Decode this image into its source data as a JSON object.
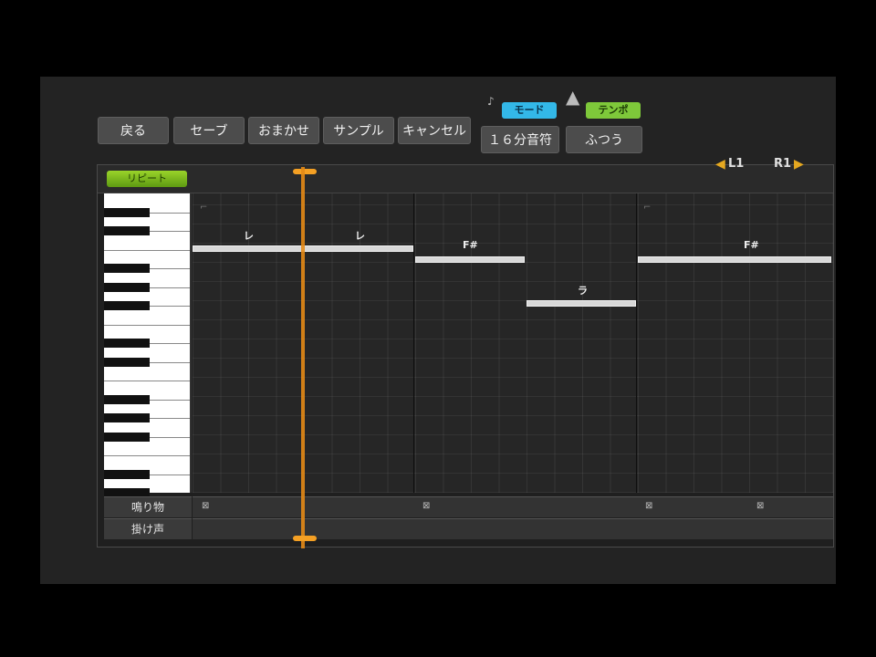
{
  "toolbar": {
    "buttons": [
      "戻る",
      "セーブ",
      "おまかせ",
      "サンプル",
      "キャンセル"
    ]
  },
  "mode": {
    "tag": "モード",
    "value": "１６分音符",
    "tag_color": "#33b8e8"
  },
  "tempo": {
    "tag": "テンポ",
    "value": "ふつう",
    "tag_color": "#7ec83a"
  },
  "editor": {
    "repeat_label": "リピート",
    "l1": "L1",
    "r1": "R1",
    "notes": [
      {
        "lyric": "レ"
      },
      {
        "lyric": "レ"
      },
      {
        "lyric": "F#"
      },
      {
        "lyric": "ラ"
      },
      {
        "lyric": "F#"
      }
    ],
    "rows": [
      {
        "label": "鳴り物"
      },
      {
        "label": "掛け声"
      }
    ]
  }
}
